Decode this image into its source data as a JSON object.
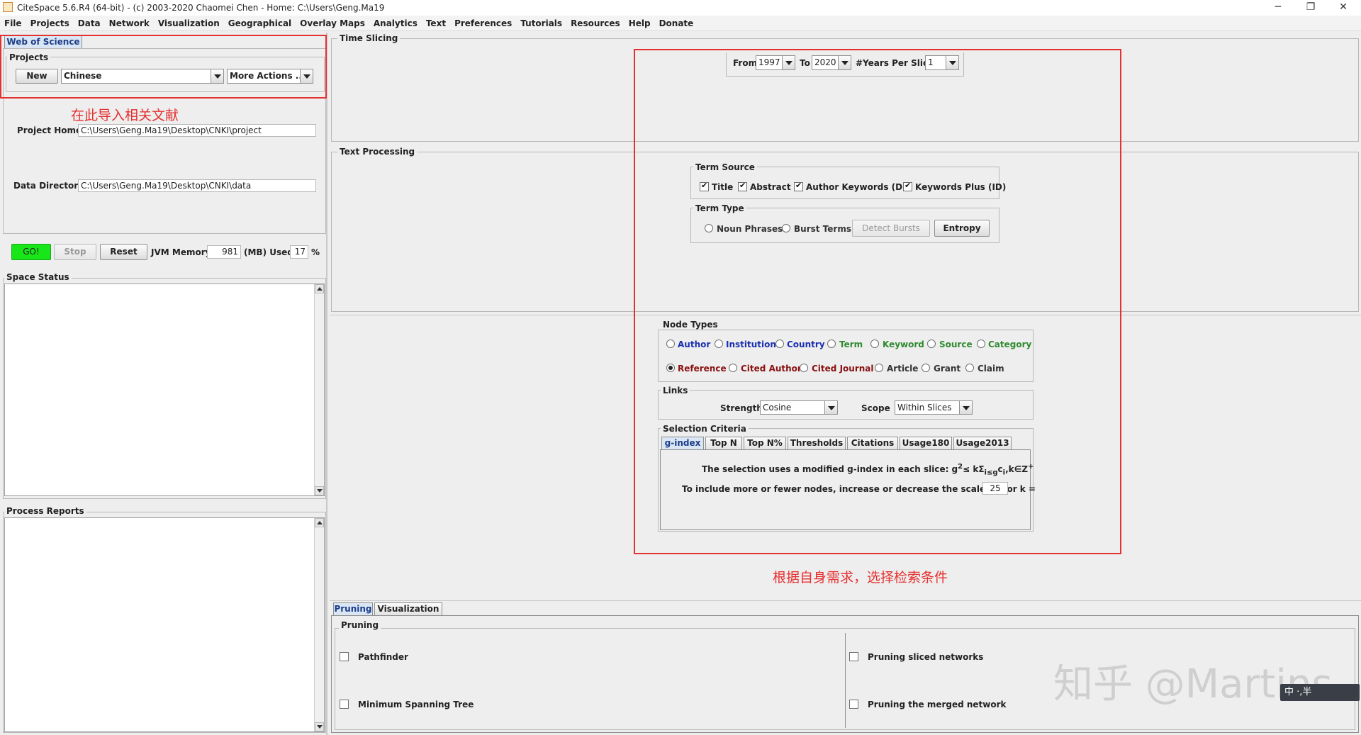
{
  "window": {
    "title": "CiteSpace 5.6.R4 (64-bit) - (c) 2003-2020 Chaomei Chen - Home: C:\\Users\\Geng.Ma19",
    "controls": [
      "─",
      "❐",
      "✕"
    ]
  },
  "menu": [
    "File",
    "Projects",
    "Data",
    "Network",
    "Visualization",
    "Geographical",
    "Overlay Maps",
    "Analytics",
    "Text",
    "Preferences",
    "Tutorials",
    "Resources",
    "Help",
    "Donate"
  ],
  "left": {
    "tab": "Web of Science",
    "projects": {
      "title": "Projects",
      "new_label": "New",
      "project_value": "Chinese",
      "more_actions": "More Actions ..."
    },
    "annotation": "在此导入相关文献",
    "project_home_label": "Project Home:",
    "project_home_value": "C:\\Users\\Geng.Ma19\\Desktop\\CNKI\\project",
    "data_dir_label": "Data Directory:",
    "data_dir_value": "C:\\Users\\Geng.Ma19\\Desktop\\CNKI\\data",
    "go_label": "GO!",
    "stop_label": "Stop",
    "reset_label": "Reset",
    "jvm_label": "JVM Memory",
    "jvm_value": "981",
    "used_label": "(MB) Used",
    "used_value": "17",
    "percent": "%",
    "space_status": "Space Status",
    "process_reports": "Process Reports"
  },
  "time_slicing": {
    "title": "Time Slicing",
    "from_label": "From",
    "from_value": "1997",
    "to_label": "To",
    "to_value": "2020",
    "years_label": "#Years Per Slice",
    "years_value": "1"
  },
  "text_processing": {
    "title": "Text Processing",
    "term_source": {
      "title": "Term Source",
      "title_label": "Title",
      "abstract_label": "Abstract",
      "author_kw_label": "Author Keywords (DE)",
      "kw_plus_label": "Keywords Plus (ID)"
    },
    "term_type": {
      "title": "Term Type",
      "noun_label": "Noun Phrases",
      "burst_label": "Burst Terms",
      "detect_label": "Detect Bursts",
      "entropy_label": "Entropy"
    }
  },
  "node_types": {
    "title": "Node Types",
    "row1": [
      "Author",
      "Institution",
      "Country",
      "Term",
      "Keyword",
      "Source",
      "Category"
    ],
    "row2": [
      "Reference",
      "Cited Author",
      "Cited Journal",
      "Article",
      "Grant",
      "Claim"
    ]
  },
  "links": {
    "title": "Links",
    "strength_label": "Strength",
    "strength_value": "Cosine",
    "scope_label": "Scope",
    "scope_value": "Within Slices"
  },
  "selection": {
    "title": "Selection Criteria",
    "tabs": [
      "g-index",
      "Top N",
      "Top N%",
      "Thresholds",
      "Citations",
      "Usage180",
      "Usage2013"
    ],
    "line1_prefix": "The selection uses a modified g-index in each slice: g",
    "line1_sup": "2",
    "line1_mid": "≤ kΣ",
    "line1_sub": "i≤g",
    "line1_c": "c",
    "line1_sub2": "i",
    "line1_end": ",k∈Z",
    "line1_sup2": "+",
    "line2": "To include more or fewer nodes, increase or decrease the scale factor k =",
    "k_value": "25"
  },
  "annotation_right": "根据自身需求，选择检索条件",
  "bottom": {
    "tabs": [
      "Pruning",
      "Visualization"
    ],
    "pruning_title": "Pruning",
    "pathfinder": "Pathfinder",
    "mst": "Minimum Spanning Tree",
    "pruning_sliced": "Pruning sliced networks",
    "pruning_merged": "Pruning the merged network"
  },
  "watermark": "知乎 @Martins",
  "ime_text": "中 ·,半"
}
